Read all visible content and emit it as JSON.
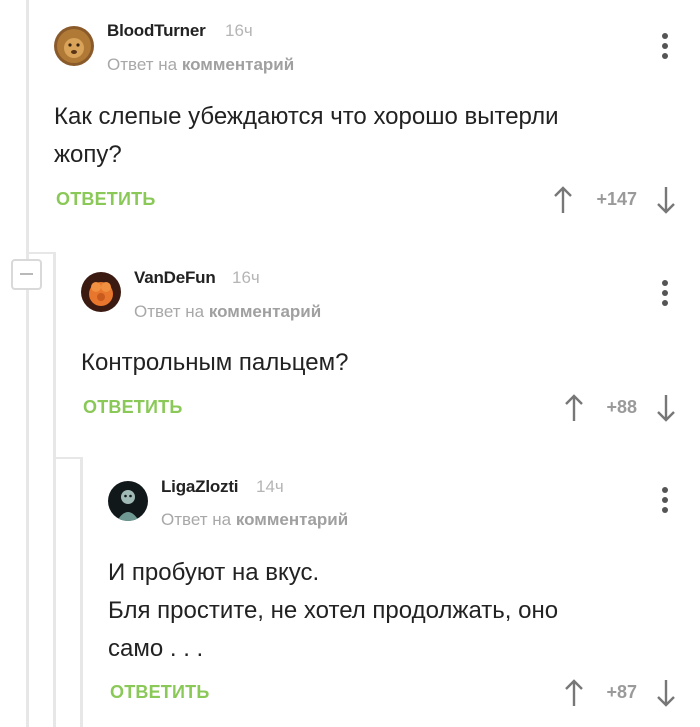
{
  "thread": {
    "collapse_label": "−"
  },
  "comments": [
    {
      "author": "BloodTurner",
      "time": "16ч",
      "reply_prefix": "Ответ на",
      "reply_link": "комментарий",
      "lines": [
        "Как слепые убеждаются что хорошо вытерли",
        "жопу?"
      ],
      "reply_button": "ОТВЕТИТЬ",
      "rating": "+147",
      "avatar_icon": "lion-avatar"
    },
    {
      "author": "VanDeFun",
      "time": "16ч",
      "reply_prefix": "Ответ на",
      "reply_link": "комментарий",
      "lines": [
        "Контрольным пальцем?"
      ],
      "reply_button": "ОТВЕТИТЬ",
      "rating": "+88",
      "avatar_icon": "orange-figure-avatar"
    },
    {
      "author": "LigaZlozti",
      "time": "14ч",
      "reply_prefix": "Ответ на",
      "reply_link": "комментарий",
      "lines": [
        "И пробуют на вкус.",
        "Бля простите, не хотел продолжать, оно",
        "само . . ."
      ],
      "reply_button": "ОТВЕТИТЬ",
      "rating": "+87",
      "avatar_icon": "dark-figure-avatar"
    }
  ],
  "colors": {
    "reply_green": "#8ac858",
    "thread_line": "#e7e7e7",
    "meta_grey": "#a8a8a8"
  }
}
